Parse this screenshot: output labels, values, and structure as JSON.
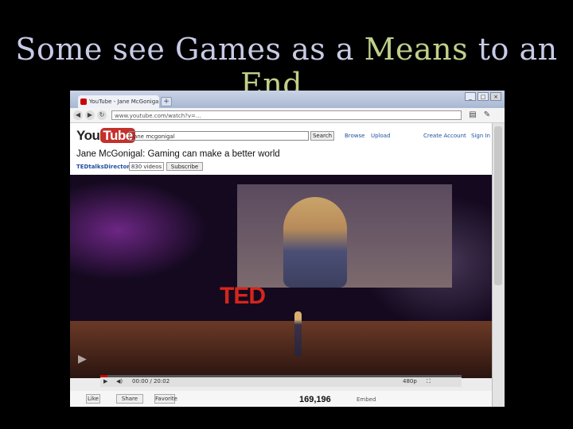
{
  "slide": {
    "title_parts": [
      {
        "text": "Some see ",
        "highlight": false
      },
      {
        "text": "G",
        "highlight": false
      },
      {
        "text": "ames as a ",
        "highlight": false
      },
      {
        "text": "M",
        "highlight": true
      },
      {
        "text": "eans",
        "highlight": true
      },
      {
        "text": " to an ",
        "highlight": false
      },
      {
        "text": "End",
        "highlight": true
      },
      {
        "text": "...",
        "highlight": false
      }
    ],
    "colors": {
      "title": "#c7cbe6",
      "highlight": "#bfd08a",
      "background": "#000000"
    }
  },
  "browser": {
    "tab_title": "YouTube - Jane McGonigal...",
    "new_tab_glyph": "+",
    "window_buttons": [
      "_",
      "□",
      "×"
    ],
    "address": "www.youtube.com/watch?v=...",
    "icons": [
      "back-icon",
      "forward-icon",
      "reload-icon",
      "page-icon",
      "wrench-icon"
    ]
  },
  "youtube": {
    "logo_you": "You",
    "logo_tube": "Tube",
    "search_value": "jane mcgonigal",
    "search_button": "Search",
    "nav": [
      "Browse",
      "Upload",
      "Create Account",
      "Sign In"
    ],
    "video_title": "Jane McGonigal: Gaming can make a better world",
    "channel": "TEDtalksDirector",
    "video_count": "830 videos",
    "subscribe_label": "Subscribe",
    "stage_logo": "TED",
    "time": "00:00 / 20:02",
    "quality": "480p",
    "views": "169,196",
    "embed_label": "Embed",
    "action_buttons": [
      "Like",
      "Share",
      "Favorite"
    ]
  }
}
